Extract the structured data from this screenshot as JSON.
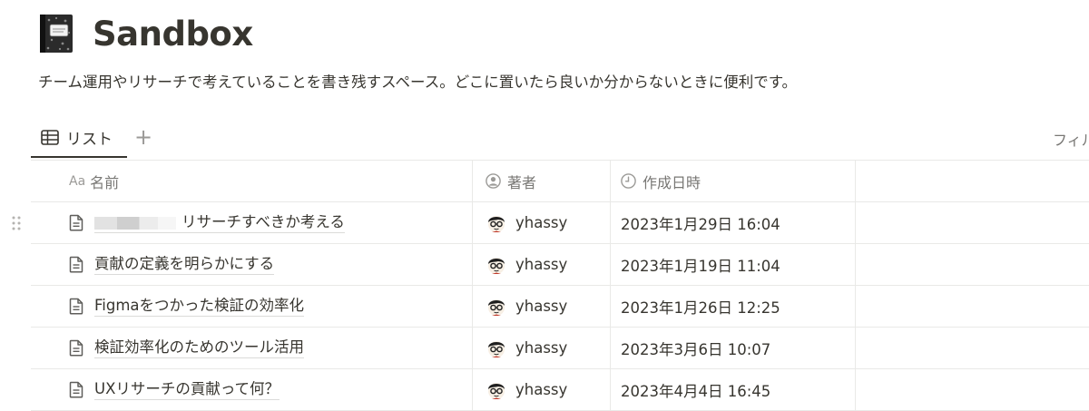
{
  "page": {
    "icon": "composition-notebook-icon",
    "title": "Sandbox",
    "description": "チーム運用やリサーチで考えていることを書き残すスペース。どこに置いたら良いか分からないときに便利です。"
  },
  "view": {
    "tab_label": "リスト",
    "add_view": "+",
    "filter_label": "フィルタ"
  },
  "table": {
    "columns": [
      {
        "prefix": "Aa",
        "label": "名前"
      },
      {
        "icon": "person-icon",
        "label": "著者"
      },
      {
        "icon": "clock-icon",
        "label": "作成日時"
      }
    ],
    "rows": [
      {
        "title": "リサーチすべきか考える",
        "title_redacted": true,
        "author": "yhassy",
        "created": "2023年1月29日 16:04"
      },
      {
        "title": "貢献の定義を明らかにする",
        "author": "yhassy",
        "created": "2023年1月19日 11:04"
      },
      {
        "title": "Figmaをつかった検証の効率化",
        "author": "yhassy",
        "created": "2023年1月26日 12:25"
      },
      {
        "title": "検証効率化のためのツール活用",
        "author": "yhassy",
        "created": "2023年3月6日 10:07"
      },
      {
        "title": "UXリサーチの貢献って何？",
        "author": "yhassy",
        "created": "2023年4月4日 16:45"
      }
    ]
  },
  "colors": {
    "text": "#37352f",
    "muted": "#787774",
    "border": "#e9e9e7"
  }
}
